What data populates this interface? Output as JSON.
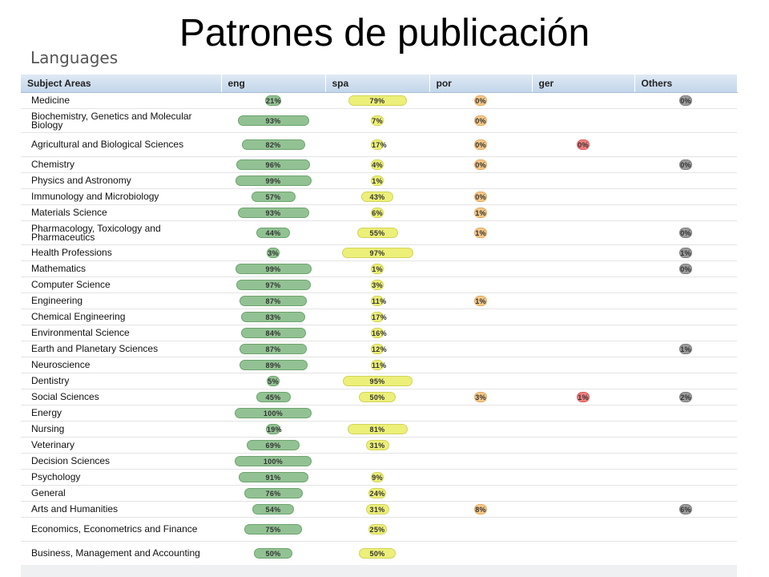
{
  "title": "Patrones de publicación",
  "subtitle": "Languages",
  "headers": [
    "Subject Areas",
    "eng",
    "spa",
    "por",
    "ger",
    "Others"
  ],
  "colors": {
    "eng": "#92c293",
    "spa": "#ecef78",
    "por": "#f5c98a",
    "ger": "#f07f7f",
    "others": "#9c9c9c",
    "header": "#c9daec"
  },
  "rows": [
    {
      "name": "Medicine",
      "vals": [
        "21%",
        "79%",
        "0%",
        "",
        "0%"
      ]
    },
    {
      "name": "Biochemistry, Genetics and Molecular Biology",
      "vals": [
        "93%",
        "7%",
        "0%",
        "",
        ""
      ]
    },
    {
      "name": "Agricultural and Biological Sciences",
      "vals": [
        "82%",
        "17%",
        "0%",
        "0%",
        ""
      ]
    },
    {
      "name": "Chemistry",
      "vals": [
        "96%",
        "4%",
        "0%",
        "",
        "0%"
      ]
    },
    {
      "name": "Physics and Astronomy",
      "vals": [
        "99%",
        "1%",
        "",
        "",
        ""
      ]
    },
    {
      "name": "Immunology and Microbiology",
      "vals": [
        "57%",
        "43%",
        "0%",
        "",
        ""
      ]
    },
    {
      "name": "Materials Science",
      "vals": [
        "93%",
        "6%",
        "1%",
        "",
        ""
      ]
    },
    {
      "name": "Pharmacology, Toxicology and Pharmaceutics",
      "vals": [
        "44%",
        "55%",
        "1%",
        "",
        "0%"
      ]
    },
    {
      "name": "Health Professions",
      "vals": [
        "3%",
        "97%",
        "",
        "",
        "1%"
      ]
    },
    {
      "name": "Mathematics",
      "vals": [
        "99%",
        "1%",
        "",
        "",
        "0%"
      ]
    },
    {
      "name": "Computer Science",
      "vals": [
        "97%",
        "3%",
        "",
        "",
        ""
      ]
    },
    {
      "name": "Engineering",
      "vals": [
        "87%",
        "11%",
        "1%",
        "",
        ""
      ]
    },
    {
      "name": "Chemical Engineering",
      "vals": [
        "83%",
        "17%",
        "",
        "",
        ""
      ]
    },
    {
      "name": "Environmental Science",
      "vals": [
        "84%",
        "16%",
        "",
        "",
        ""
      ]
    },
    {
      "name": "Earth and Planetary Sciences",
      "vals": [
        "87%",
        "12%",
        "",
        "",
        "1%"
      ]
    },
    {
      "name": "Neuroscience",
      "vals": [
        "89%",
        "11%",
        "",
        "",
        ""
      ]
    },
    {
      "name": "Dentistry",
      "vals": [
        "5%",
        "95%",
        "",
        "",
        ""
      ]
    },
    {
      "name": "Social Sciences",
      "vals": [
        "45%",
        "50%",
        "3%",
        "1%",
        "2%"
      ]
    },
    {
      "name": "Energy",
      "vals": [
        "100%",
        "",
        "",
        "",
        ""
      ]
    },
    {
      "name": "Nursing",
      "vals": [
        "19%",
        "81%",
        "",
        "",
        ""
      ]
    },
    {
      "name": "Veterinary",
      "vals": [
        "69%",
        "31%",
        "",
        "",
        ""
      ]
    },
    {
      "name": "Decision Sciences",
      "vals": [
        "100%",
        "",
        "",
        "",
        ""
      ]
    },
    {
      "name": "Psychology",
      "vals": [
        "91%",
        "9%",
        "",
        "",
        ""
      ]
    },
    {
      "name": "General",
      "vals": [
        "76%",
        "24%",
        "",
        "",
        ""
      ]
    },
    {
      "name": "Arts and Humanities",
      "vals": [
        "54%",
        "31%",
        "8%",
        "",
        "6%"
      ]
    },
    {
      "name": "Economics, Econometrics and Finance",
      "vals": [
        "75%",
        "25%",
        "",
        "",
        ""
      ]
    },
    {
      "name": "Business, Management and Accounting",
      "vals": [
        "50%",
        "50%",
        "",
        "",
        ""
      ]
    }
  ]
}
